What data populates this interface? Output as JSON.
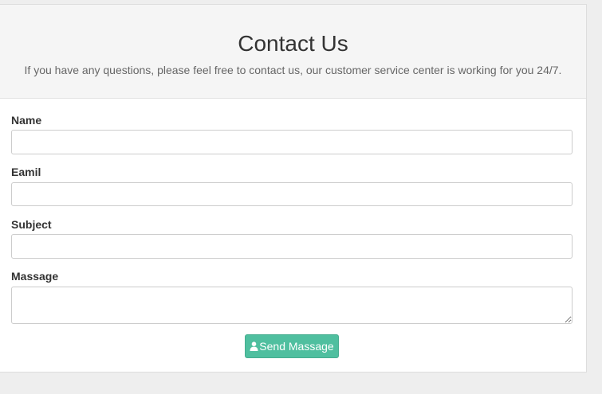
{
  "header": {
    "title": "Contact Us",
    "subtitle": "If you have any questions, please feel free to contact us, our customer service center is working for you 24/7."
  },
  "form": {
    "fields": [
      {
        "label": "Name",
        "value": "",
        "placeholder": ""
      },
      {
        "label": "Eamil",
        "value": "",
        "placeholder": ""
      },
      {
        "label": "Subject",
        "value": "",
        "placeholder": ""
      },
      {
        "label": "Massage",
        "value": "",
        "placeholder": ""
      }
    ],
    "submit": {
      "label": "Send Massage",
      "icon": "user-icon"
    }
  },
  "colors": {
    "button_bg": "#4fbf9f",
    "header_bg": "#f5f5f5",
    "page_bg": "#eeeeee"
  }
}
